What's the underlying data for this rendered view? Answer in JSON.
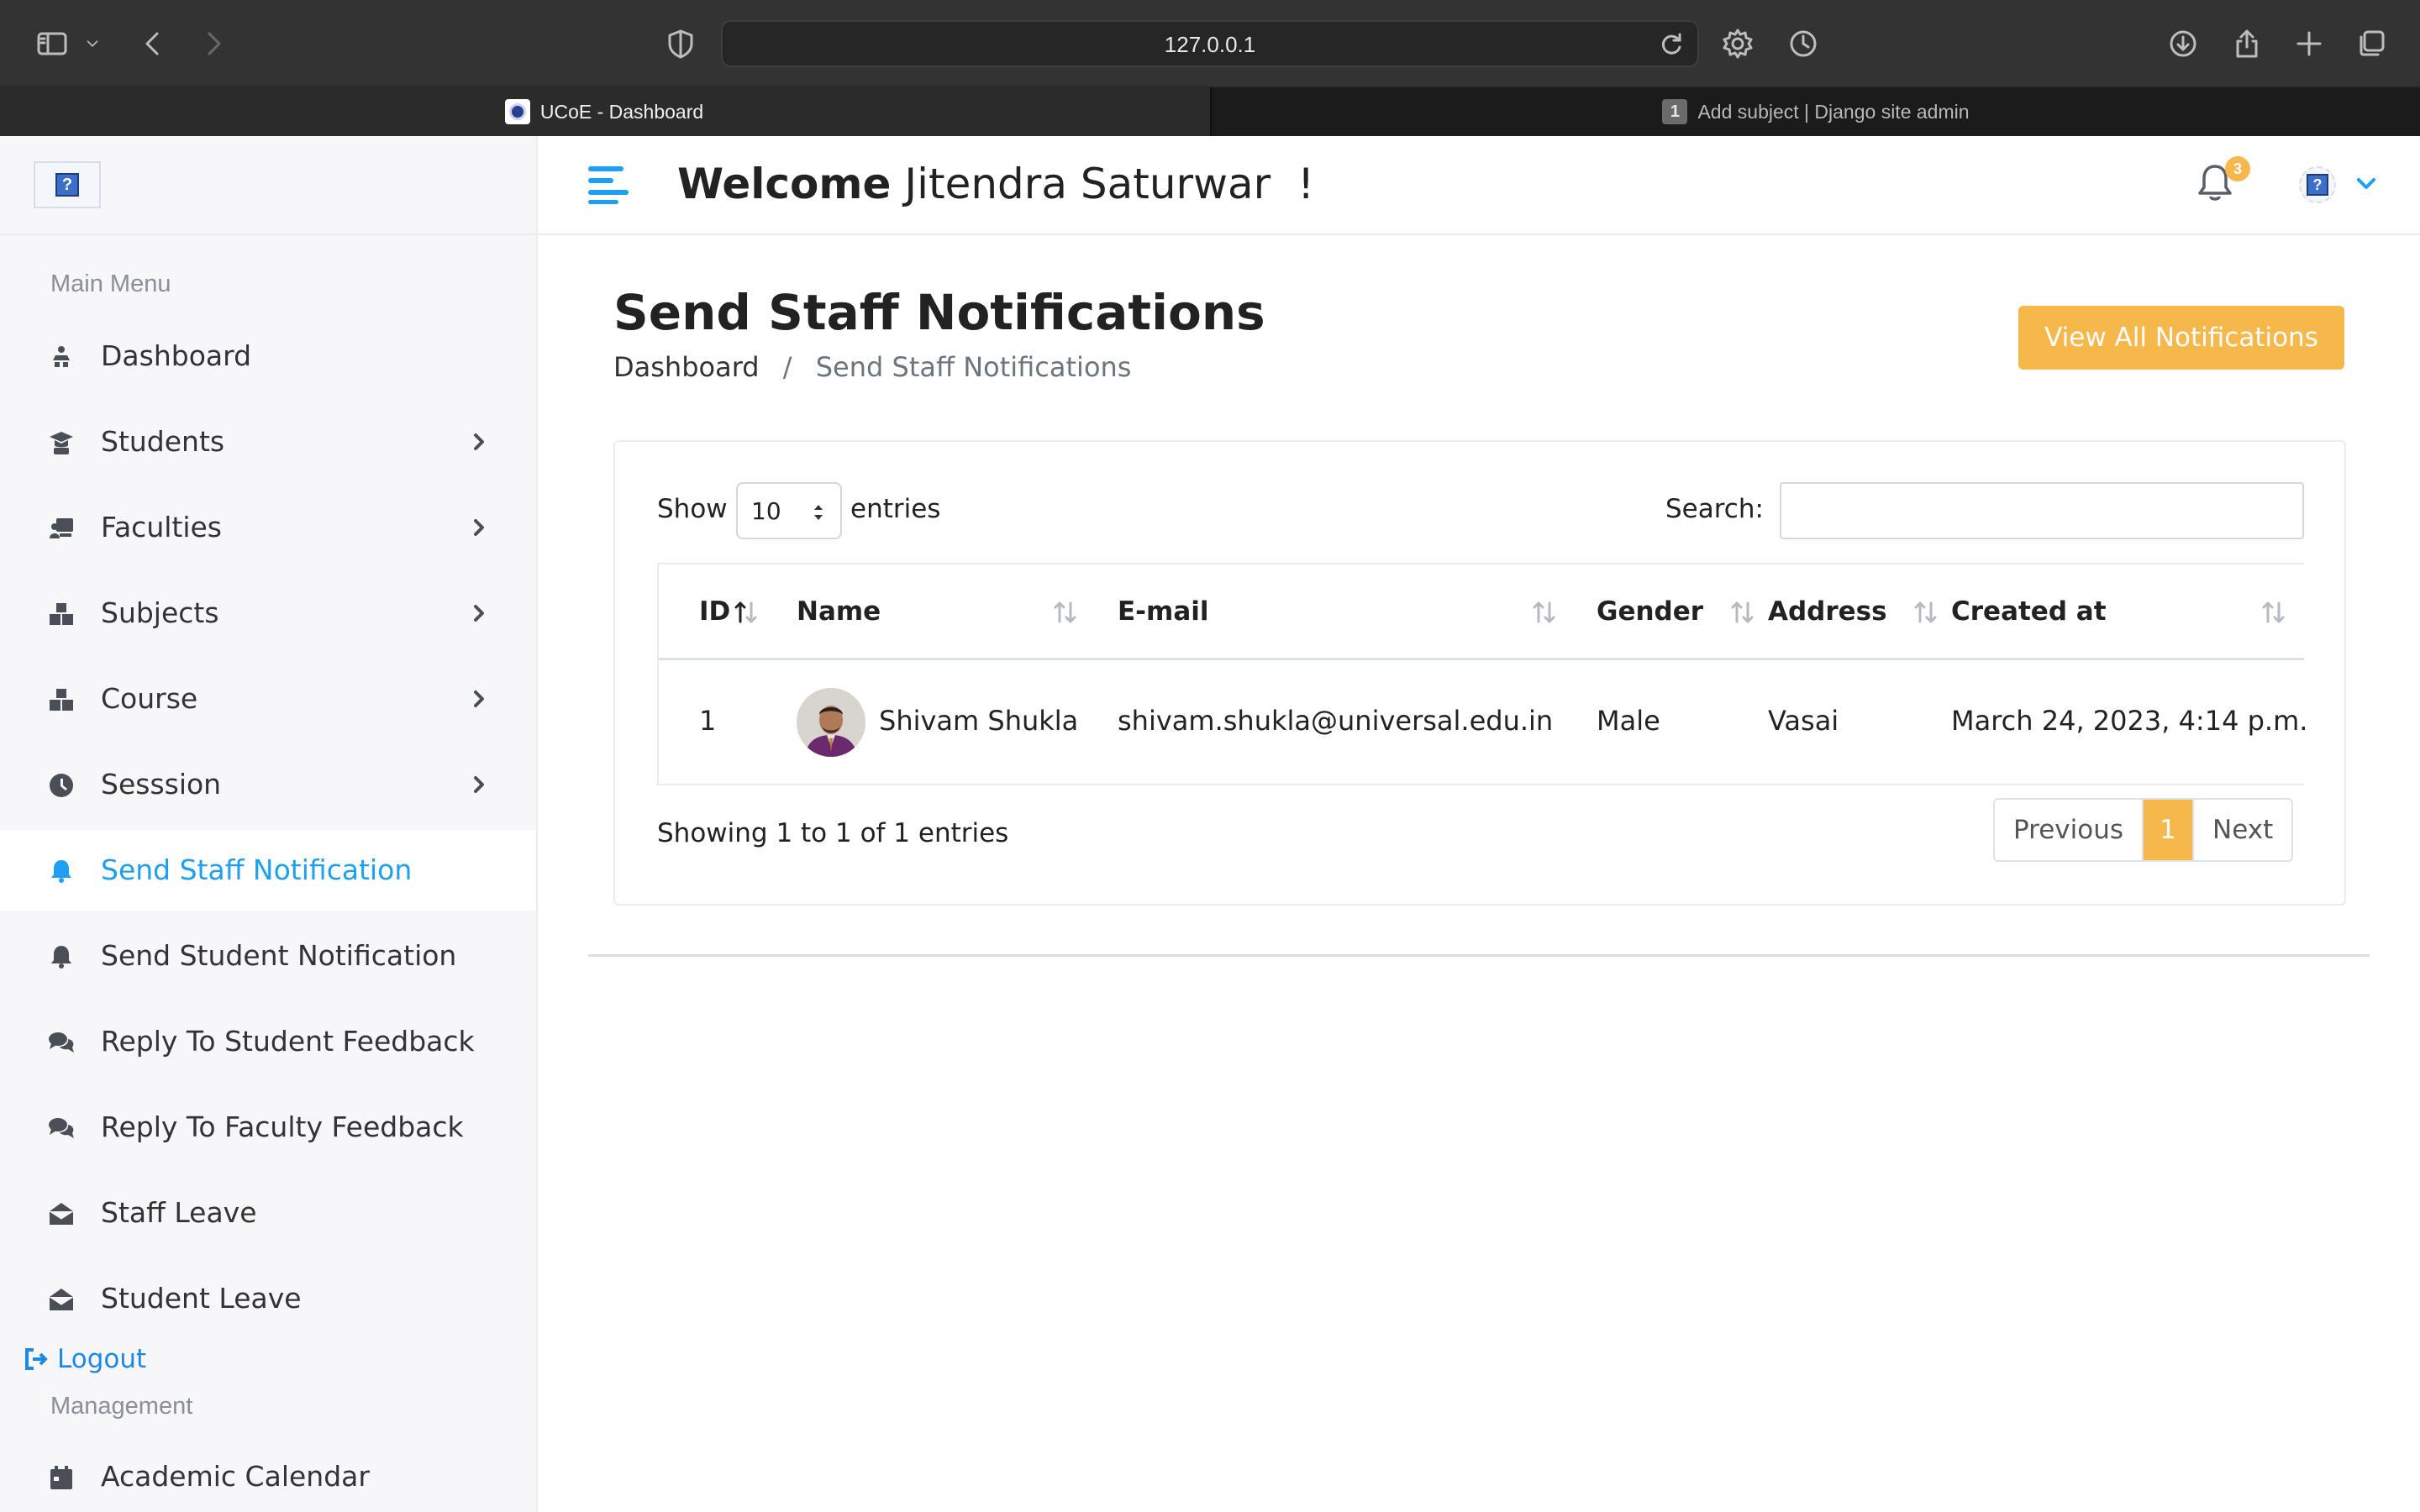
{
  "browser": {
    "url": "127.0.0.1",
    "tabs": [
      {
        "title": "UCoE - Dashboard",
        "active": true
      },
      {
        "title": "Add subject | Django site admin",
        "active": false,
        "badge": "1"
      }
    ]
  },
  "header": {
    "welcome_bold": "Welcome",
    "welcome_name": "Jitendra Saturwar",
    "welcome_suffix": "!",
    "notification_count": "3",
    "accent_color": "#1e9ff2"
  },
  "sidebar": {
    "main_menu_title": "Main Menu",
    "items": [
      {
        "label": "Dashboard",
        "icon": "dashboard-icon",
        "has_submenu": false
      },
      {
        "label": "Students",
        "icon": "graduate-icon",
        "has_submenu": true
      },
      {
        "label": "Faculties",
        "icon": "teacher-icon",
        "has_submenu": true
      },
      {
        "label": "Subjects",
        "icon": "cubes-icon",
        "has_submenu": true
      },
      {
        "label": "Course",
        "icon": "cubes-icon",
        "has_submenu": true
      },
      {
        "label": "Sesssion",
        "icon": "clock-icon",
        "has_submenu": true
      },
      {
        "label": "Send Staff Notification",
        "icon": "bell-icon",
        "has_submenu": false,
        "active": true
      },
      {
        "label": "Send Student Notification",
        "icon": "bell-icon",
        "has_submenu": false
      },
      {
        "label": "Reply To Student Feedback",
        "icon": "comments-icon",
        "has_submenu": false
      },
      {
        "label": "Reply To Faculty Feedback",
        "icon": "comments-icon",
        "has_submenu": false
      },
      {
        "label": "Staff Leave",
        "icon": "envelope-open-icon",
        "has_submenu": false
      },
      {
        "label": "Student Leave",
        "icon": "envelope-open-icon",
        "has_submenu": false
      }
    ],
    "logout_label": "Logout",
    "management_title": "Management",
    "management_items": [
      {
        "label": "Academic Calendar",
        "icon": "calendar-icon"
      }
    ]
  },
  "page": {
    "title": "Send Staff Notifications",
    "breadcrumb": {
      "home": "Dashboard",
      "separator": "/",
      "current": "Send Staff Notifications"
    },
    "view_all_button": "View All Notifications",
    "button_color": "#f7b84b"
  },
  "table": {
    "show_label": "Show",
    "entries_value": "10",
    "entries_label": "entries",
    "search_label": "Search:",
    "search_value": "",
    "columns": [
      "ID",
      "Name",
      "E-mail",
      "Gender",
      "Address",
      "Created at"
    ],
    "rows": [
      {
        "id": "1",
        "name": "Shivam Shukla",
        "email": "shivam.shukla@universal.edu.in",
        "gender": "Male",
        "address": "Vasai",
        "created_at": "March 24, 2023, 4:14 p.m."
      }
    ],
    "info": "Showing 1 to 1 of 1 entries",
    "pagination": {
      "previous": "Previous",
      "current": "1",
      "next": "Next"
    }
  }
}
